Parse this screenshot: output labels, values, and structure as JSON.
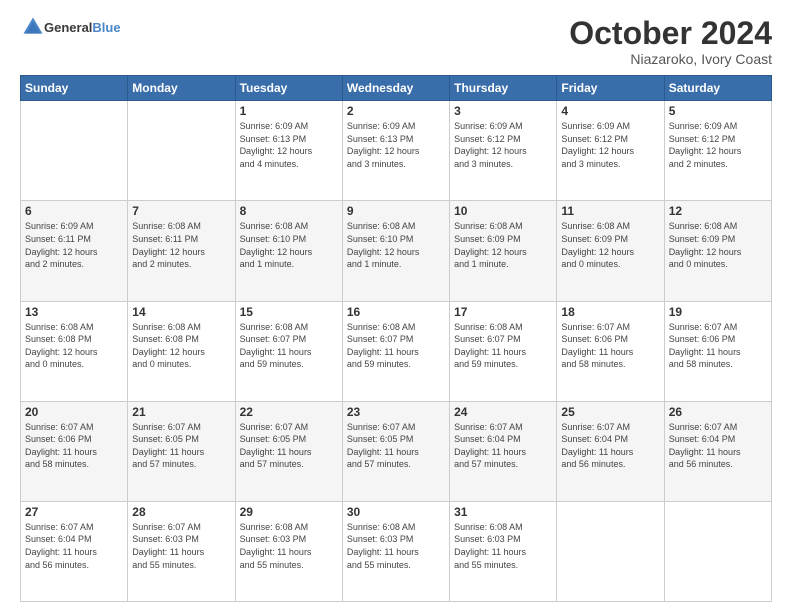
{
  "logo": {
    "line1": "General",
    "line2": "Blue"
  },
  "title": "October 2024",
  "subtitle": "Niazaroko, Ivory Coast",
  "weekdays": [
    "Sunday",
    "Monday",
    "Tuesday",
    "Wednesday",
    "Thursday",
    "Friday",
    "Saturday"
  ],
  "weeks": [
    [
      {
        "day": "",
        "info": ""
      },
      {
        "day": "",
        "info": ""
      },
      {
        "day": "1",
        "info": "Sunrise: 6:09 AM\nSunset: 6:13 PM\nDaylight: 12 hours\nand 4 minutes."
      },
      {
        "day": "2",
        "info": "Sunrise: 6:09 AM\nSunset: 6:13 PM\nDaylight: 12 hours\nand 3 minutes."
      },
      {
        "day": "3",
        "info": "Sunrise: 6:09 AM\nSunset: 6:12 PM\nDaylight: 12 hours\nand 3 minutes."
      },
      {
        "day": "4",
        "info": "Sunrise: 6:09 AM\nSunset: 6:12 PM\nDaylight: 12 hours\nand 3 minutes."
      },
      {
        "day": "5",
        "info": "Sunrise: 6:09 AM\nSunset: 6:12 PM\nDaylight: 12 hours\nand 2 minutes."
      }
    ],
    [
      {
        "day": "6",
        "info": "Sunrise: 6:09 AM\nSunset: 6:11 PM\nDaylight: 12 hours\nand 2 minutes."
      },
      {
        "day": "7",
        "info": "Sunrise: 6:08 AM\nSunset: 6:11 PM\nDaylight: 12 hours\nand 2 minutes."
      },
      {
        "day": "8",
        "info": "Sunrise: 6:08 AM\nSunset: 6:10 PM\nDaylight: 12 hours\nand 1 minute."
      },
      {
        "day": "9",
        "info": "Sunrise: 6:08 AM\nSunset: 6:10 PM\nDaylight: 12 hours\nand 1 minute."
      },
      {
        "day": "10",
        "info": "Sunrise: 6:08 AM\nSunset: 6:09 PM\nDaylight: 12 hours\nand 1 minute."
      },
      {
        "day": "11",
        "info": "Sunrise: 6:08 AM\nSunset: 6:09 PM\nDaylight: 12 hours\nand 0 minutes."
      },
      {
        "day": "12",
        "info": "Sunrise: 6:08 AM\nSunset: 6:09 PM\nDaylight: 12 hours\nand 0 minutes."
      }
    ],
    [
      {
        "day": "13",
        "info": "Sunrise: 6:08 AM\nSunset: 6:08 PM\nDaylight: 12 hours\nand 0 minutes."
      },
      {
        "day": "14",
        "info": "Sunrise: 6:08 AM\nSunset: 6:08 PM\nDaylight: 12 hours\nand 0 minutes."
      },
      {
        "day": "15",
        "info": "Sunrise: 6:08 AM\nSunset: 6:07 PM\nDaylight: 11 hours\nand 59 minutes."
      },
      {
        "day": "16",
        "info": "Sunrise: 6:08 AM\nSunset: 6:07 PM\nDaylight: 11 hours\nand 59 minutes."
      },
      {
        "day": "17",
        "info": "Sunrise: 6:08 AM\nSunset: 6:07 PM\nDaylight: 11 hours\nand 59 minutes."
      },
      {
        "day": "18",
        "info": "Sunrise: 6:07 AM\nSunset: 6:06 PM\nDaylight: 11 hours\nand 58 minutes."
      },
      {
        "day": "19",
        "info": "Sunrise: 6:07 AM\nSunset: 6:06 PM\nDaylight: 11 hours\nand 58 minutes."
      }
    ],
    [
      {
        "day": "20",
        "info": "Sunrise: 6:07 AM\nSunset: 6:06 PM\nDaylight: 11 hours\nand 58 minutes."
      },
      {
        "day": "21",
        "info": "Sunrise: 6:07 AM\nSunset: 6:05 PM\nDaylight: 11 hours\nand 57 minutes."
      },
      {
        "day": "22",
        "info": "Sunrise: 6:07 AM\nSunset: 6:05 PM\nDaylight: 11 hours\nand 57 minutes."
      },
      {
        "day": "23",
        "info": "Sunrise: 6:07 AM\nSunset: 6:05 PM\nDaylight: 11 hours\nand 57 minutes."
      },
      {
        "day": "24",
        "info": "Sunrise: 6:07 AM\nSunset: 6:04 PM\nDaylight: 11 hours\nand 57 minutes."
      },
      {
        "day": "25",
        "info": "Sunrise: 6:07 AM\nSunset: 6:04 PM\nDaylight: 11 hours\nand 56 minutes."
      },
      {
        "day": "26",
        "info": "Sunrise: 6:07 AM\nSunset: 6:04 PM\nDaylight: 11 hours\nand 56 minutes."
      }
    ],
    [
      {
        "day": "27",
        "info": "Sunrise: 6:07 AM\nSunset: 6:04 PM\nDaylight: 11 hours\nand 56 minutes."
      },
      {
        "day": "28",
        "info": "Sunrise: 6:07 AM\nSunset: 6:03 PM\nDaylight: 11 hours\nand 55 minutes."
      },
      {
        "day": "29",
        "info": "Sunrise: 6:08 AM\nSunset: 6:03 PM\nDaylight: 11 hours\nand 55 minutes."
      },
      {
        "day": "30",
        "info": "Sunrise: 6:08 AM\nSunset: 6:03 PM\nDaylight: 11 hours\nand 55 minutes."
      },
      {
        "day": "31",
        "info": "Sunrise: 6:08 AM\nSunset: 6:03 PM\nDaylight: 11 hours\nand 55 minutes."
      },
      {
        "day": "",
        "info": ""
      },
      {
        "day": "",
        "info": ""
      }
    ]
  ]
}
